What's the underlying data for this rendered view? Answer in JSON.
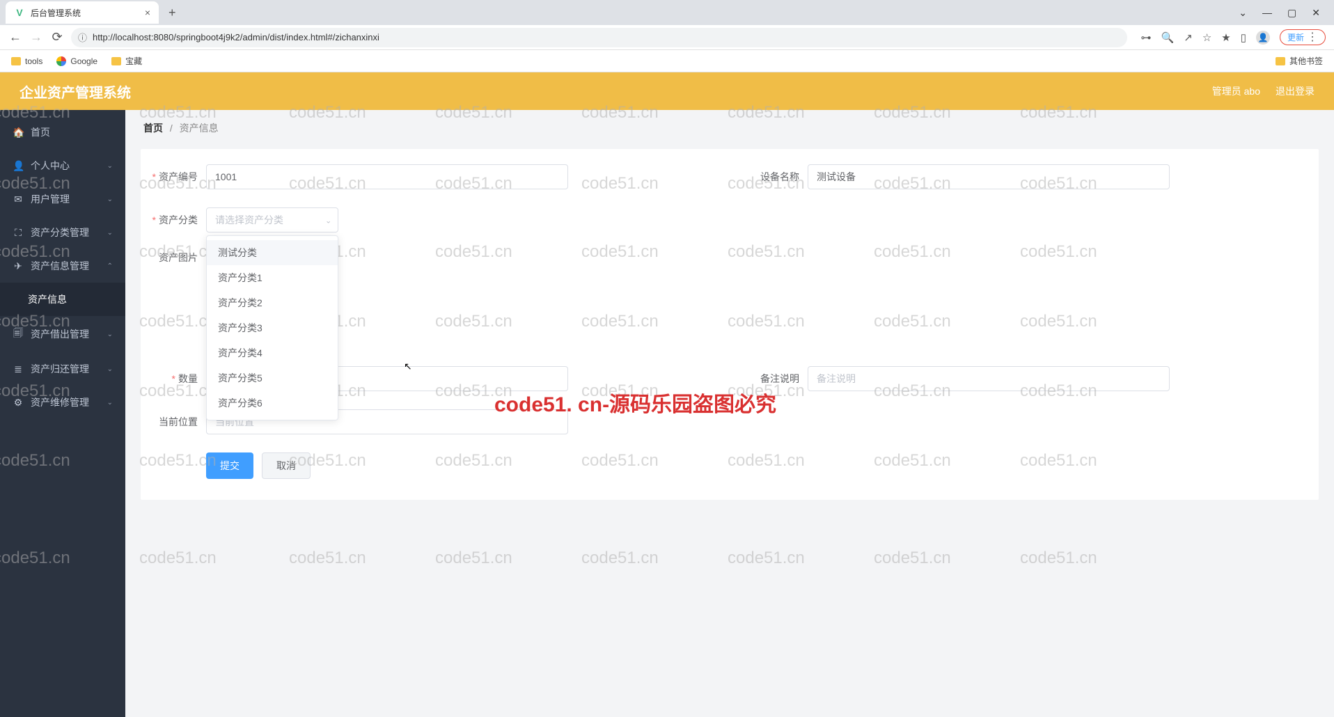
{
  "browser": {
    "tab_title": "后台管理系统",
    "url": "http://localhost:8080/springboot4j9k2/admin/dist/index.html#/zichanxinxi",
    "update_btn": "更新",
    "bookmarks": {
      "tools": "tools",
      "google": "Google",
      "treasure": "宝藏",
      "other": "其他书签"
    }
  },
  "header": {
    "app_title": "企业资产管理系统",
    "admin_label": "管理员 abo",
    "logout": "退出登录"
  },
  "sidebar": {
    "items": [
      {
        "icon": "🏠",
        "label": "首页"
      },
      {
        "icon": "👤",
        "label": "个人中心"
      },
      {
        "icon": "✉",
        "label": "用户管理"
      },
      {
        "icon": "⛶",
        "label": "资产分类管理"
      },
      {
        "icon": "✈",
        "label": "资产信息管理"
      },
      {
        "icon": "",
        "label": "资产信息"
      },
      {
        "icon": "🗐",
        "label": "资产借出管理"
      },
      {
        "icon": "≣",
        "label": "资产归还管理"
      },
      {
        "icon": "⚙",
        "label": "资产维修管理"
      }
    ]
  },
  "breadcrumb": {
    "home": "首页",
    "current": "资产信息"
  },
  "form": {
    "asset_code_label": "资产编号",
    "asset_code_value": "1001",
    "device_name_label": "设备名称",
    "device_name_value": "测试设备",
    "asset_category_label": "资产分类",
    "asset_category_placeholder": "请选择资产分类",
    "asset_image_label": "资产图片",
    "quantity_label": "数量",
    "remark_label": "备注说明",
    "remark_placeholder": "备注说明",
    "location_label": "当前位置",
    "location_placeholder": "当前位置",
    "submit": "提交",
    "cancel": "取消"
  },
  "dropdown_options": [
    "测试分类",
    "资产分类1",
    "资产分类2",
    "资产分类3",
    "资产分类4",
    "资产分类5",
    "资产分类6"
  ],
  "watermark": {
    "repeat": "code51.cn",
    "center": "code51. cn-源码乐园盗图必究"
  }
}
